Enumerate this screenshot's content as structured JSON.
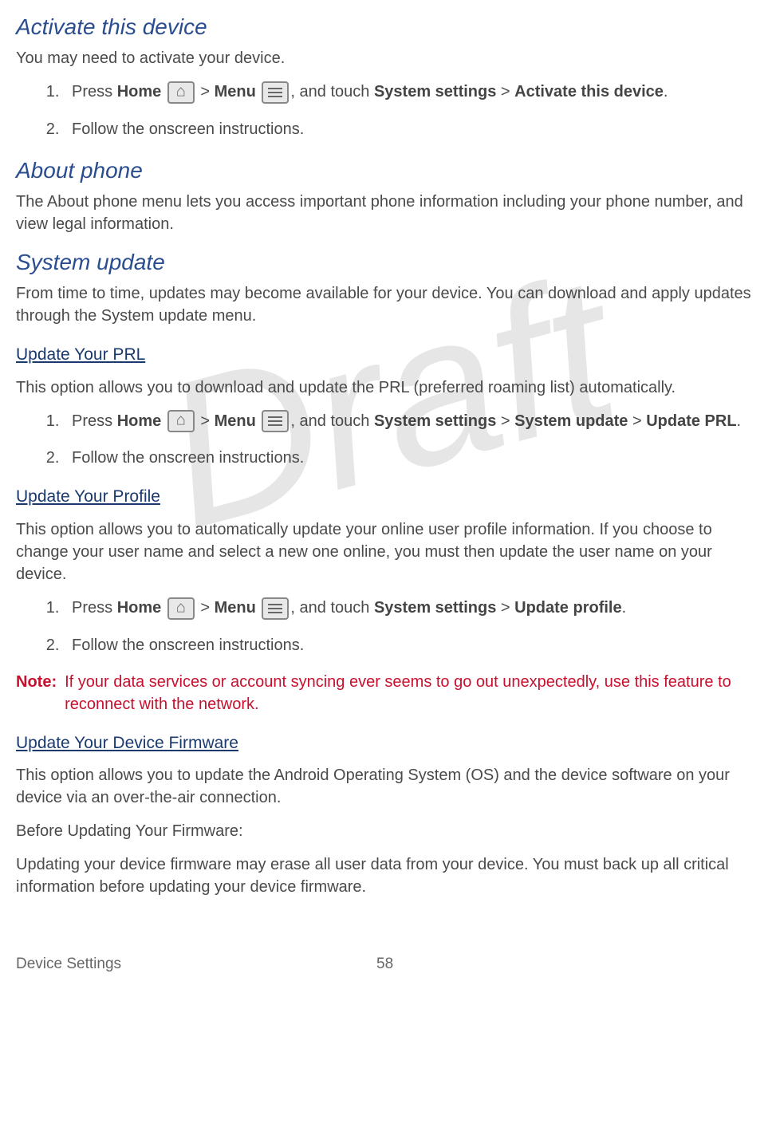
{
  "watermark": "Draft",
  "sections": {
    "activate": {
      "heading": "Activate this device",
      "intro": "You may need to activate your device.",
      "step1_pre": "Press ",
      "home_label": "Home",
      "gt1": " > ",
      "menu_label": "Menu",
      "step1_mid": ", and touch ",
      "syssettings": "System settings",
      "gt2": " > ",
      "target": "Activate this device",
      "step1_end": ".",
      "step2": "Follow the onscreen instructions."
    },
    "about": {
      "heading": "About phone",
      "text": "The About phone menu lets you access important phone information including your phone number, and view legal information."
    },
    "sysupdate": {
      "heading": "System update",
      "intro": "From time to time, updates may become available for your device. You can download and apply updates through the System update menu."
    },
    "prl": {
      "heading": "Update Your PRL",
      "text": "This option allows you to download and update the PRL (preferred roaming list) automatically.",
      "step1_pre": "Press ",
      "home_label": "Home",
      "gt1": " > ",
      "menu_label": "Menu",
      "step1_mid": ", and touch ",
      "syssettings": "System settings",
      "gt2": " > ",
      "sysupdate": "System update",
      "gt3": " > ",
      "target": "Update PRL",
      "step1_end": ".",
      "step2": "Follow the onscreen instructions."
    },
    "profile": {
      "heading": "Update Your Profile",
      "text": "This option allows you to automatically update your online user profile information. If you choose to change your user name and select a new one online, you must then update the user name on your device.",
      "step1_pre": "Press ",
      "home_label": "Home",
      "gt1": " > ",
      "menu_label": "Menu",
      "step1_mid": ", and touch ",
      "syssettings": "System settings",
      "gt2": " > ",
      "target": "Update profile",
      "step1_end": ".",
      "step2": "Follow the onscreen instructions.",
      "note_label": "Note:",
      "note_text": "If your data services or account syncing ever seems to go out unexpectedly, use this feature to reconnect with the network."
    },
    "firmware": {
      "heading": "Update Your Device Firmware",
      "p1": "This option allows you to update the Android Operating System (OS) and the device software on your device via an over-the-air connection.",
      "p2": "Before Updating Your Firmware:",
      "p3": "Updating your device firmware may erase all user data from your device. You must back up all critical information before updating your device firmware."
    }
  },
  "footer": {
    "left": "Device Settings",
    "page": "58"
  }
}
